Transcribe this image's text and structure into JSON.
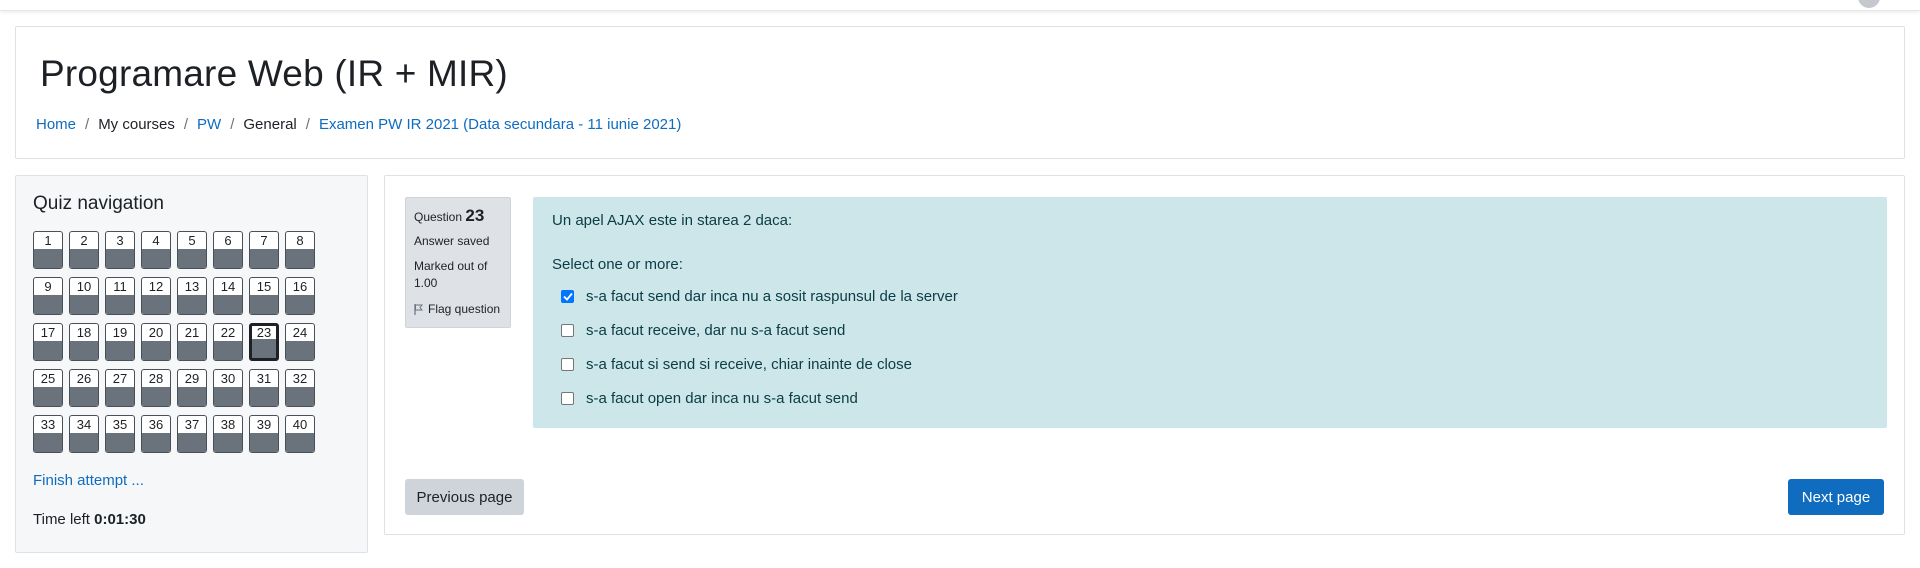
{
  "header": {
    "title": "Programare Web (IR + MIR)",
    "breadcrumb": [
      {
        "label": "Home",
        "link": true
      },
      {
        "label": "My courses",
        "link": false
      },
      {
        "label": "PW",
        "link": true
      },
      {
        "label": "General",
        "link": false
      },
      {
        "label": "Examen PW IR 2021 (Data secundara - 11 iunie 2021)",
        "link": true
      }
    ],
    "separator": "/"
  },
  "quiz_nav": {
    "title": "Quiz navigation",
    "questions": [
      "1",
      "2",
      "3",
      "4",
      "5",
      "6",
      "7",
      "8",
      "9",
      "10",
      "11",
      "12",
      "13",
      "14",
      "15",
      "16",
      "17",
      "18",
      "19",
      "20",
      "21",
      "22",
      "23",
      "24",
      "25",
      "26",
      "27",
      "28",
      "29",
      "30",
      "31",
      "32",
      "33",
      "34",
      "35",
      "36",
      "37",
      "38",
      "39",
      "40"
    ],
    "current": "23",
    "finish_label": "Finish attempt ...",
    "time_label": "Time left",
    "time_value": "0:01:30"
  },
  "question": {
    "label": "Question",
    "number": "23",
    "state": "Answer saved",
    "marked": "Marked out of",
    "max_mark": "1.00",
    "flag_label": "Flag question",
    "text": "Un apel AJAX este in starea 2 daca:",
    "prompt": "Select one or more:",
    "answers": [
      {
        "text": "s-a facut send dar inca nu a sosit raspunsul de la server",
        "checked": true
      },
      {
        "text": "s-a facut receive, dar nu s-a facut send",
        "checked": false
      },
      {
        "text": "s-a facut si send si receive, chiar inainte de close",
        "checked": false
      },
      {
        "text": "s-a facut open dar inca nu s-a facut send",
        "checked": false
      }
    ]
  },
  "buttons": {
    "previous": "Previous page",
    "next": "Next page"
  },
  "colors": {
    "link": "#0f6cbf",
    "formulation_bg": "#cce6ea",
    "answered_fill": "#6a737b",
    "primary": "#0f6cbf"
  }
}
